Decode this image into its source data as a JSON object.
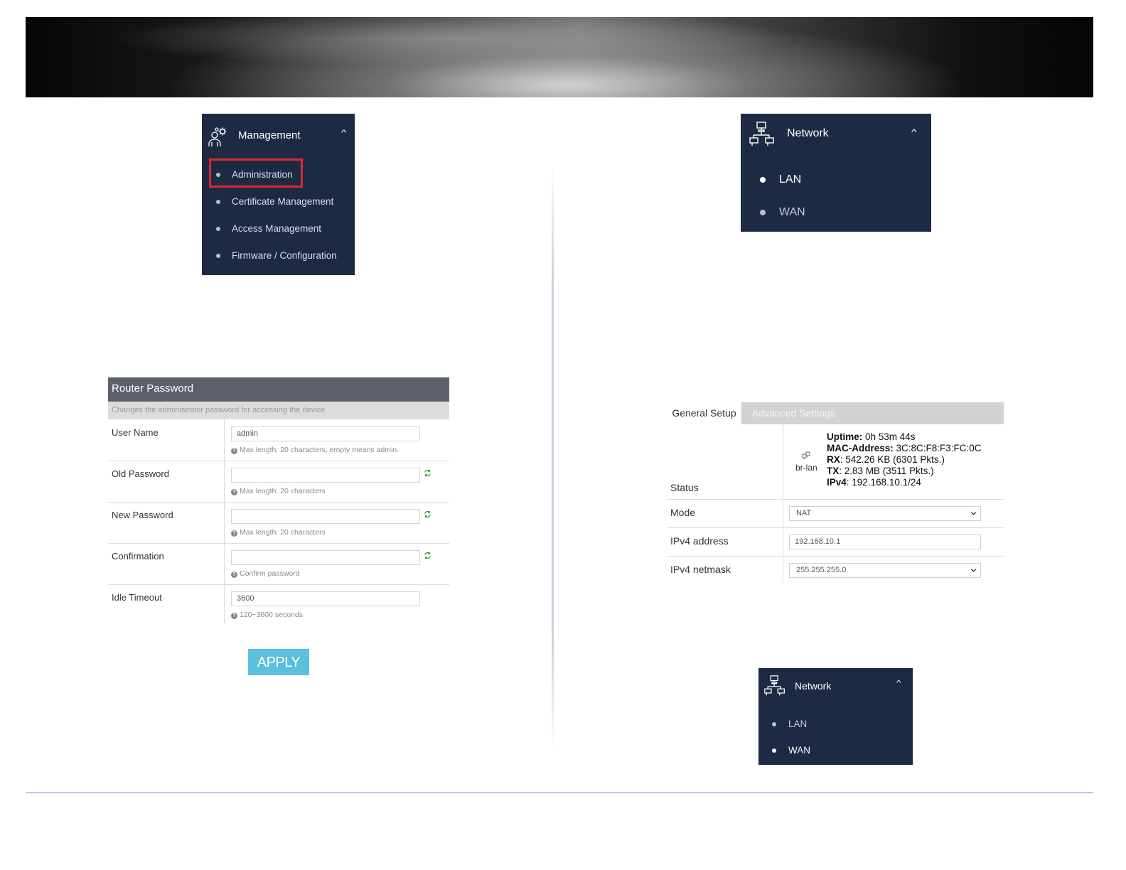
{
  "management_menu": {
    "title": "Management",
    "icon": "admin-gears-icon",
    "items": [
      {
        "label": "Administration",
        "highlighted": true
      },
      {
        "label": "Certificate Management"
      },
      {
        "label": "Access Management"
      },
      {
        "label": "Firmware / Configuration"
      }
    ]
  },
  "network_menu_lan": {
    "title": "Network",
    "icon": "network-icon",
    "items": [
      {
        "label": "LAN",
        "active": true
      },
      {
        "label": "WAN",
        "active": false
      }
    ]
  },
  "network_menu_wan": {
    "title": "Network",
    "icon": "network-icon",
    "items": [
      {
        "label": "LAN",
        "active": false
      },
      {
        "label": "WAN",
        "active": true
      }
    ]
  },
  "router_password": {
    "title": "Router Password",
    "description": "Changes the administrator password for accessing the device",
    "fields": [
      {
        "label": "User Name",
        "value": "admin",
        "hint": "Max length: 20 characters, empty means admin."
      },
      {
        "label": "Old Password",
        "value": "",
        "hint": "Max length: 20 characters"
      },
      {
        "label": "New Password",
        "value": "",
        "hint": "Max length: 20 characters"
      },
      {
        "label": "Confirmation",
        "value": "",
        "hint": "Confirm password"
      },
      {
        "label": "Idle Timeout",
        "value": "3600",
        "hint": "120~3600 seconds"
      }
    ],
    "apply_label": "APPLY"
  },
  "lan_settings": {
    "tabs": [
      "General Setup",
      "Advanced Settings"
    ],
    "status": {
      "label": "Status",
      "interface": "br-lan",
      "uptime_label": "Uptime:",
      "uptime": "0h 53m 44s",
      "mac_label": "MAC-Address:",
      "mac": "3C:8C:F8:F3:FC:0C",
      "rx_label": "RX",
      "rx": ": 542.26 KB (6301 Pkts.)",
      "tx_label": "TX",
      "tx": ": 2.83 MB (3511 Pkts.)",
      "ipv4_label": "IPv4",
      "ipv4": ": 192.168.10.1/24"
    },
    "mode_label": "Mode",
    "mode_value": "NAT",
    "ipv4_address_label": "IPv4 address",
    "ipv4_address_value": "192.168.10.1",
    "ipv4_netmask_label": "IPv4 netmask",
    "ipv4_netmask_value": "255.255.255.0"
  },
  "colors": {
    "nav_bg": "#1c2a44",
    "highlight": "#e0282d",
    "apply_btn": "#5bc0de",
    "panel_header": "#5d6169"
  }
}
